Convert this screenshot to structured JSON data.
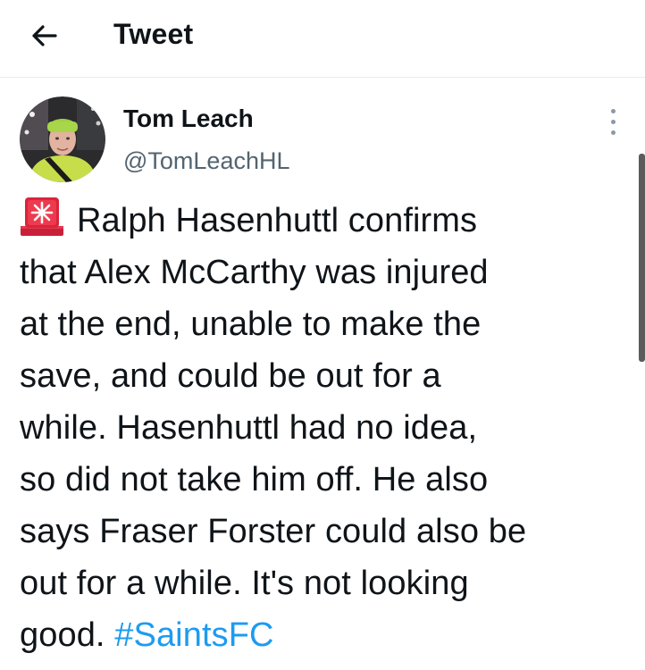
{
  "header": {
    "title": "Tweet",
    "back_icon": "arrow-left-icon"
  },
  "author": {
    "name": "Tom Leach",
    "handle": "@TomLeachHL",
    "more_icon": "more-vertical-icon"
  },
  "tweet": {
    "emoji": "siren-icon",
    "lines": [
      "Ralph Hasenhuttl confirms",
      "that Alex McCarthy was injured",
      "at the end, unable to make the",
      "save, and could be out for a",
      "while. Hasenhuttl had no idea,",
      "so did not take him off. He also",
      "says Fraser Forster could also be",
      "out for a while. It's not looking",
      "good."
    ],
    "hashtag": "#SaintsFC"
  },
  "colors": {
    "text": "#0f1419",
    "secondary_text": "#536471",
    "link": "#1d9bf0",
    "divider": "#e6ecf0"
  }
}
